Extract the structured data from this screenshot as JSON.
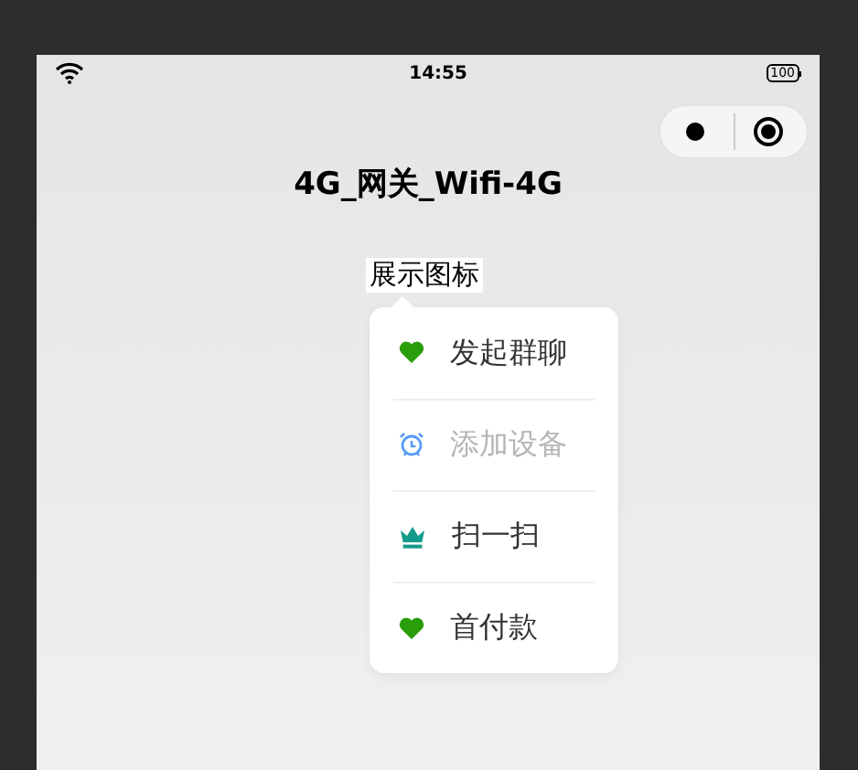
{
  "status_bar": {
    "time": "14:55",
    "battery": "100"
  },
  "nav": {
    "title": "4G_网关_Wifi-4G"
  },
  "trigger": {
    "label": "展示图标"
  },
  "menu": [
    {
      "label": "发起群聊",
      "kind": "heart",
      "color": "#2a9d0a",
      "disabled": false
    },
    {
      "label": "添加设备",
      "kind": "alarm",
      "color": "#5a9cf8",
      "disabled": true
    },
    {
      "label": "扫一扫",
      "kind": "crown",
      "color": "#129a8a",
      "disabled": false
    },
    {
      "label": "首付款",
      "kind": "heart",
      "color": "#2a9d0a",
      "disabled": false
    }
  ]
}
